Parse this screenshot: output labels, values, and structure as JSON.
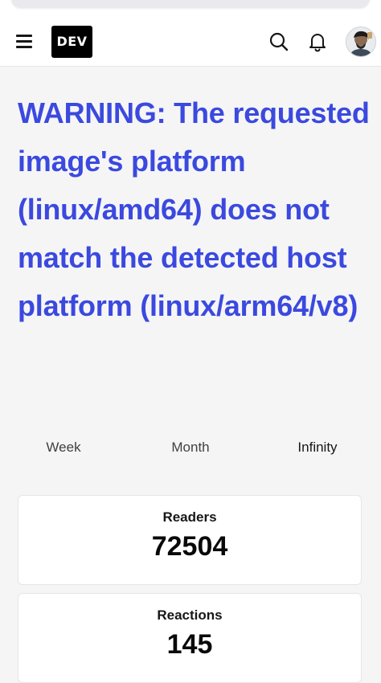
{
  "header": {
    "logo_text": "DEV",
    "icons": [
      "menu-icon",
      "search-icon",
      "bell-icon",
      "avatar"
    ]
  },
  "article": {
    "title": "WARNING: The requested image's platform (linux/amd64) does not match the detected host platform (linux/arm64/v8)"
  },
  "period_tabs": [
    {
      "label": "Week",
      "active": false
    },
    {
      "label": "Month",
      "active": false
    },
    {
      "label": "Infinity",
      "active": true
    }
  ],
  "stats": [
    {
      "label": "Readers",
      "value": "72504"
    },
    {
      "label": "Reactions",
      "value": "145"
    }
  ],
  "colors": {
    "accent": "#3b49df",
    "background": "#f5f5f5",
    "card": "#ffffff",
    "logo_bg": "#000000"
  }
}
